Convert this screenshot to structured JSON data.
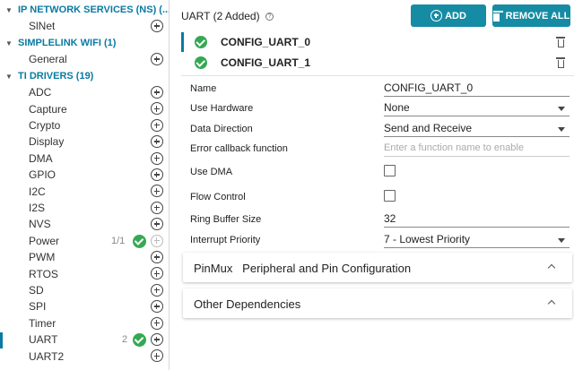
{
  "sidebar": {
    "categories": [
      {
        "label": "IP NETWORK SERVICES (NS) (..."
      },
      {
        "label": "SIMPLELINK WIFI (1)"
      },
      {
        "label": "TI DRIVERS (19)"
      }
    ],
    "items": [
      {
        "label": "SlNet"
      },
      {
        "label": "General"
      },
      {
        "label": "ADC"
      },
      {
        "label": "Capture"
      },
      {
        "label": "Crypto"
      },
      {
        "label": "Display"
      },
      {
        "label": "DMA"
      },
      {
        "label": "GPIO"
      },
      {
        "label": "I2C"
      },
      {
        "label": "I2S"
      },
      {
        "label": "NVS"
      },
      {
        "label": "Power",
        "count": "1/1"
      },
      {
        "label": "PWM"
      },
      {
        "label": "RTOS"
      },
      {
        "label": "SD"
      },
      {
        "label": "SPI"
      },
      {
        "label": "Timer"
      },
      {
        "label": "UART",
        "count": "2"
      },
      {
        "label": "UART2"
      }
    ]
  },
  "main": {
    "title": "UART (2 Added)",
    "help_glyph": "?",
    "add_label": "ADD",
    "remove_all_label": "REMOVE ALL",
    "instances": [
      "CONFIG_UART_0",
      "CONFIG_UART_1"
    ],
    "properties": {
      "name": {
        "label": "Name",
        "value": "CONFIG_UART_0"
      },
      "use_hardware": {
        "label": "Use Hardware",
        "value": "None"
      },
      "data_direction": {
        "label": "Data Direction",
        "value": "Send and Receive"
      },
      "error_callback": {
        "label": "Error callback function",
        "placeholder": "Enter a function name to enable"
      },
      "use_dma": {
        "label": "Use DMA",
        "checked": false
      },
      "flow_control": {
        "label": "Flow Control",
        "checked": false
      },
      "ring_buffer": {
        "label": "Ring Buffer Size",
        "value": "32"
      },
      "interrupt_priority": {
        "label": "Interrupt Priority",
        "value": "7 - Lowest Priority"
      }
    },
    "sections": {
      "pinmux": "PinMux   Peripheral and Pin Configuration",
      "other": "Other Dependencies"
    }
  },
  "colors": {
    "accent": "#0a7aa3",
    "button": "#158ca3",
    "success": "#35a853"
  }
}
